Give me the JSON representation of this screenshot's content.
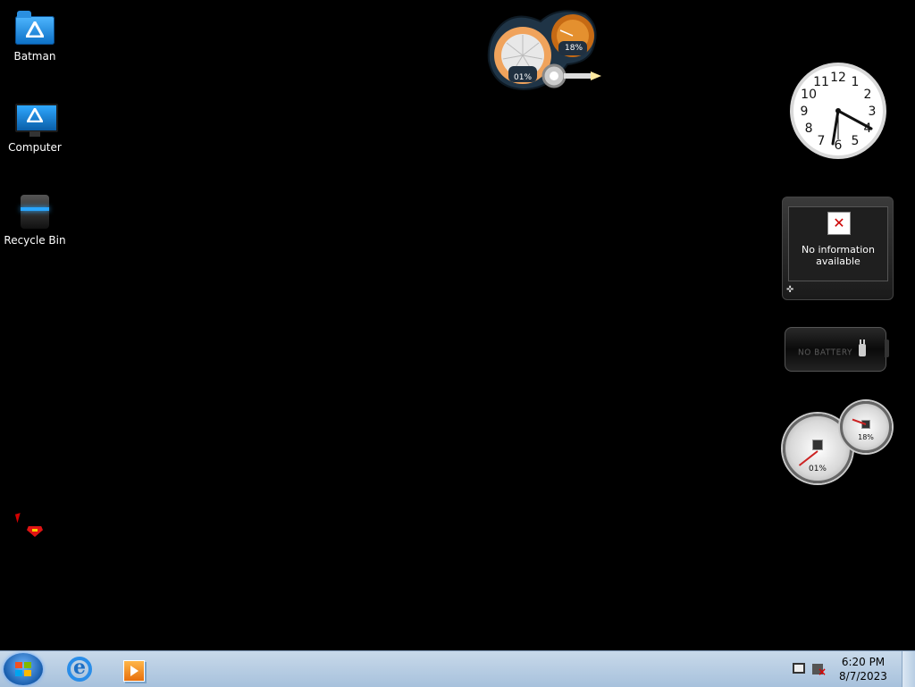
{
  "desktop": {
    "icons": [
      {
        "label": "Batman"
      },
      {
        "label": "Computer"
      },
      {
        "label": "Recycle Bin"
      }
    ]
  },
  "gadgets": {
    "fan_meter": {
      "cpu_value": "01%",
      "memory_value": "18%"
    },
    "clock": {
      "numbers": [
        "12",
        "1",
        "2",
        "3",
        "4",
        "5",
        "6",
        "7",
        "8",
        "9",
        "10",
        "11"
      ],
      "time": "4:21"
    },
    "weather": {
      "message_line1": "No information",
      "message_line2": "available"
    },
    "battery": {
      "status": "NO BATTERY"
    },
    "cpu_meter": {
      "cpu_value": "01%",
      "memory_value": "18%"
    }
  },
  "taskbar": {
    "clock_time": "6:20 PM",
    "clock_date": "8/7/2023",
    "pinned": [
      "internet-explorer-icon",
      "media-player-icon"
    ]
  },
  "colors": {
    "taskbar": "#b8cfe6",
    "desktop": "#000000",
    "accent": "#1a5fae"
  }
}
